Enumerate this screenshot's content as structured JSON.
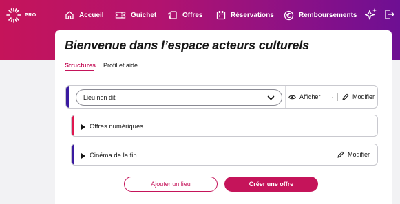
{
  "colors": {
    "brand": "#c5145a",
    "gradient_end": "#6e0f93",
    "accent_blue": "#3a1aa0",
    "accent_pink": "#e0164f"
  },
  "header": {
    "logo_label": "PRO",
    "nav": [
      {
        "label": "Accueil",
        "icon": "home-icon"
      },
      {
        "label": "Guichet",
        "icon": "ticket-icon"
      },
      {
        "label": "Offres",
        "icon": "offers-icon"
      },
      {
        "label": "Réservations",
        "icon": "calendar-icon"
      },
      {
        "label": "Remboursements",
        "icon": "euro-icon"
      }
    ],
    "extra_icons": [
      "sparkle-icon",
      "logout-icon"
    ]
  },
  "main": {
    "title": "Bienvenue dans l’espace acteurs culturels",
    "tabs": [
      {
        "label": "Structures",
        "active": true
      },
      {
        "label": "Profil et aide",
        "active": false
      }
    ],
    "venue_card": {
      "selected_venue": "Lieu non dit",
      "show_label": "Afficher",
      "edit_label": "Modifier"
    },
    "digital_offers_card": {
      "title": "Offres numériques"
    },
    "cinema_card": {
      "title": "Cinéma de la fin",
      "edit_label": "Modifier"
    },
    "buttons": {
      "add_venue": "Ajouter un lieu",
      "create_offer": "Créer une offre"
    }
  }
}
